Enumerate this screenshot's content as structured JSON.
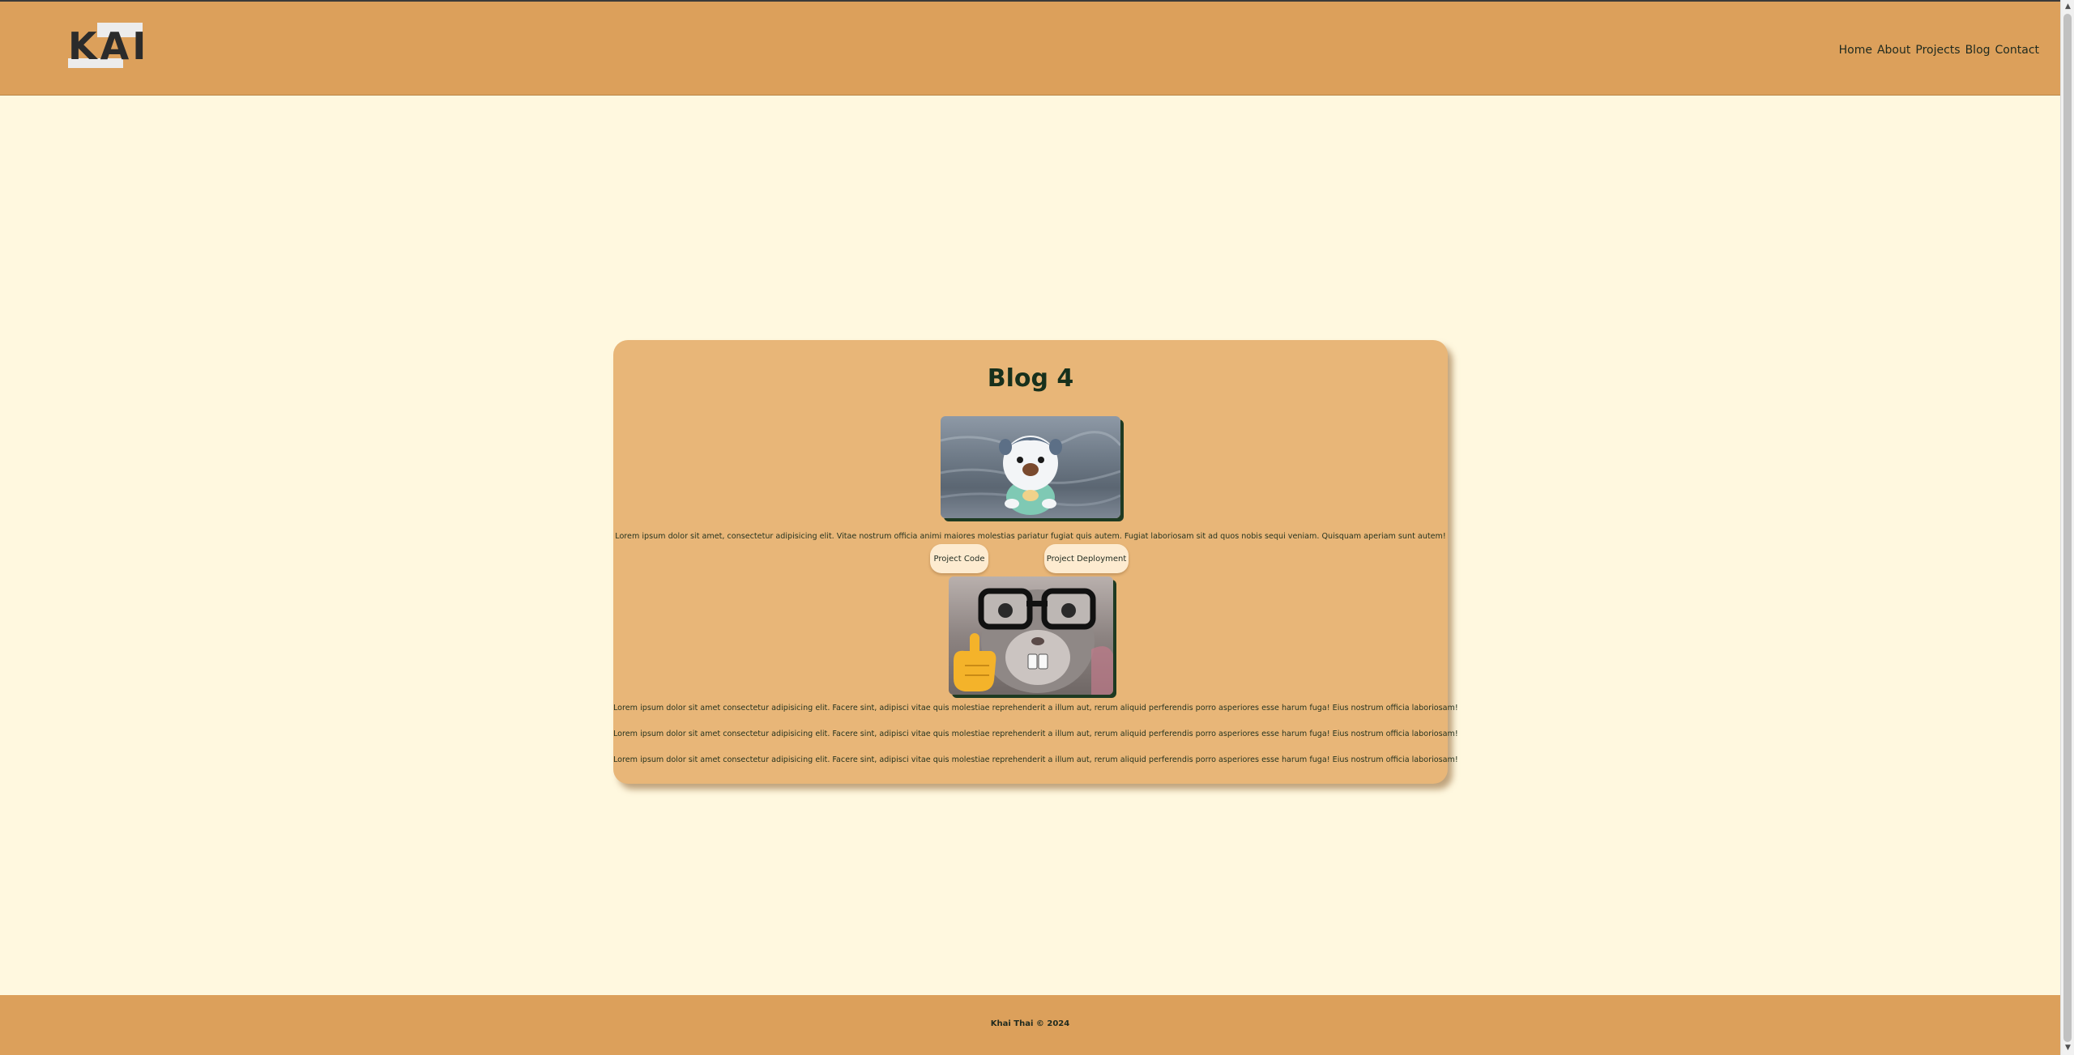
{
  "header": {
    "logo_text": "KAI",
    "nav": [
      "Home",
      "About",
      "Projects",
      "Blog",
      "Contact"
    ]
  },
  "blog": {
    "title": "Blog 4",
    "intro": "Lorem ipsum dolor sit amet, consectetur adipisicing elit. Vitae nostrum officia animi maiores molestias pariatur fugiat quis autem. Fugiat laboriosam sit ad quos nobis sequi veniam. Quisquam aperiam sunt autem!",
    "buttons": {
      "code": "Project Code",
      "deployment": "Project Deployment"
    },
    "paragraphs": [
      "Lorem ipsum dolor sit amet consectetur adipisicing elit. Facere sint, adipisci vitae quis molestiae reprehenderit a illum aut, rerum aliquid perferendis porro asperiores esse harum fuga! Eius nostrum officia laboriosam!",
      "Lorem ipsum dolor sit amet consectetur adipisicing elit. Facere sint, adipisci vitae quis molestiae reprehenderit a illum aut, rerum aliquid perferendis porro asperiores esse harum fuga! Eius nostrum officia laboriosam!",
      "Lorem ipsum dolor sit amet consectetur adipisicing elit. Facere sint, adipisci vitae quis molestiae reprehenderit a illum aut, rerum aliquid perferendis porro asperiores esse harum fuga! Eius nostrum officia laboriosam!"
    ],
    "image1_icon": "otter-pokemon-image",
    "image2_icon": "cat-with-glasses-image"
  },
  "footer": {
    "text": "Khai Thai © 2024"
  },
  "colors": {
    "background": "#fff8df",
    "header": "#dca05b",
    "card": "#e8b678",
    "text": "#1f3a23"
  }
}
